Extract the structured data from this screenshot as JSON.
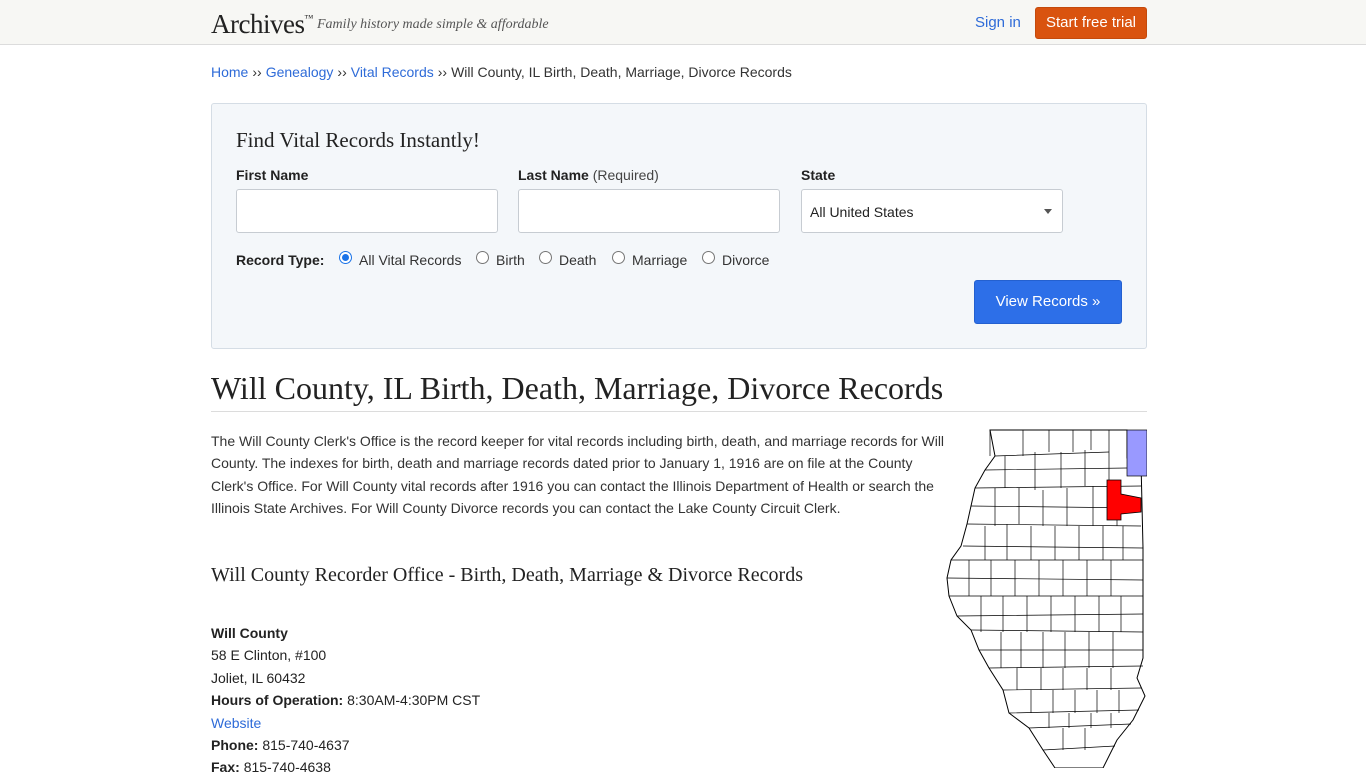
{
  "header": {
    "logo": "Archives",
    "logo_tm": "™",
    "tagline": "Family history made simple & affordable",
    "signin_label": "Sign in",
    "trial_label": "Start free trial"
  },
  "breadcrumb": {
    "items": [
      "Home",
      "Genealogy",
      "Vital Records"
    ],
    "separator": "››",
    "current": "Will County, IL Birth, Death, Marriage, Divorce Records"
  },
  "search": {
    "heading": "Find Vital Records Instantly!",
    "first_name_label": "First Name",
    "first_name_value": "",
    "last_name_label": "Last Name",
    "last_name_required": "(Required)",
    "last_name_value": "",
    "state_label": "State",
    "state_selected": "All United States",
    "record_type_label": "Record Type:",
    "record_types": [
      "All Vital Records",
      "Birth",
      "Death",
      "Marriage",
      "Divorce"
    ],
    "record_type_selected": "All Vital Records",
    "submit_label": "View Records »"
  },
  "page": {
    "title": "Will County, IL Birth, Death, Marriage, Divorce Records",
    "intro": "The Will County Clerk's Office is the record keeper for vital records including birth, death, and marriage records for Will County. The indexes for birth, death and marriage records dated prior to January 1, 1916 are on file at the County Clerk's Office. For Will County vital records after 1916 you can contact the Illinois Department of Health or search the Illinois State Archives. For Will County Divorce records you can contact the Lake County Circuit Clerk.",
    "subhead": "Will County Recorder Office - Birth, Death, Marriage & Divorce Records"
  },
  "office": {
    "name": "Will County",
    "address1": "58 E Clinton, #100",
    "address2": "Joliet, IL 60432",
    "hours_label": "Hours of Operation:",
    "hours": "8:30AM-4:30PM CST",
    "website_label": "Website",
    "phone_label": "Phone:",
    "phone": "815-740-4637",
    "fax_label": "Fax:",
    "fax": "815-740-4638"
  },
  "colors": {
    "brand_orange": "#d9530f",
    "link_blue": "#2e6bd8",
    "button_blue": "#2d6fe8",
    "map_highlight": "#ff0000",
    "map_lake": "#9999ff"
  },
  "map": {
    "highlighted_county": "Will County"
  }
}
